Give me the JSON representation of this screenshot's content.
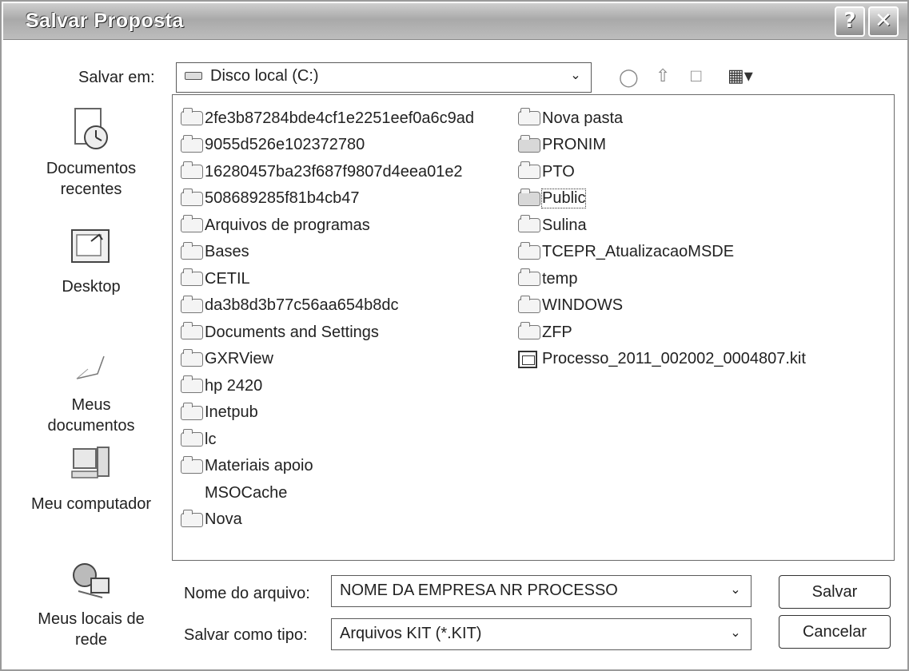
{
  "dialog": {
    "title": "Salvar Proposta",
    "help_button": "?",
    "close_button": "✕"
  },
  "toolbar": {
    "save_in_label": "Salvar em:",
    "save_in_value": "Disco local (C:)",
    "back_icon": "back-icon",
    "up_icon": "up-folder-icon",
    "new_folder_icon": "new-folder-icon",
    "views_icon": "views-menu-icon"
  },
  "places": [
    {
      "label_line1": "Documentos",
      "label_line2": "recentes",
      "icon": "recent-documents-icon"
    },
    {
      "label_line1": "Desktop",
      "label_line2": "",
      "icon": "desktop-icon"
    },
    {
      "label_line1": "Meus",
      "label_line2": "documentos",
      "icon": "my-documents-icon"
    },
    {
      "label_line1": "Meu computador",
      "label_line2": "",
      "icon": "my-computer-icon"
    },
    {
      "label_line1": "Meus locais de",
      "label_line2": "rede",
      "icon": "network-places-icon"
    }
  ],
  "files": {
    "column1": [
      {
        "name": "2fe3b87284bde4cf1e2251eef0a6c9ad",
        "type": "folder"
      },
      {
        "name": "9055d526e102372780",
        "type": "folder"
      },
      {
        "name": "16280457ba23f687f9807d4eea01e2",
        "type": "folder"
      },
      {
        "name": "508689285f81b4cb47",
        "type": "folder"
      },
      {
        "name": "Arquivos de programas",
        "type": "folder"
      },
      {
        "name": "Bases",
        "type": "folder"
      },
      {
        "name": "CETIL",
        "type": "folder"
      },
      {
        "name": "da3b8d3b77c56aa654b8dc",
        "type": "folder"
      },
      {
        "name": "Documents and Settings",
        "type": "folder"
      },
      {
        "name": "GXRView",
        "type": "folder"
      },
      {
        "name": "hp 2420",
        "type": "folder"
      },
      {
        "name": "Inetpub",
        "type": "folder"
      },
      {
        "name": "lc",
        "type": "folder"
      },
      {
        "name": "Materiais apoio",
        "type": "folder"
      },
      {
        "name": "MSOCache",
        "type": "hidden"
      },
      {
        "name": "Nova",
        "type": "folder"
      }
    ],
    "column2": [
      {
        "name": "Nova pasta",
        "type": "folder"
      },
      {
        "name": "PRONIM",
        "type": "shared"
      },
      {
        "name": "PTO",
        "type": "folder"
      },
      {
        "name": "Public",
        "type": "shared",
        "selected": true
      },
      {
        "name": "Sulina",
        "type": "folder"
      },
      {
        "name": "TCEPR_AtualizacaoMSDE",
        "type": "folder"
      },
      {
        "name": "temp",
        "type": "folder"
      },
      {
        "name": "WINDOWS",
        "type": "folder"
      },
      {
        "name": "ZFP",
        "type": "folder"
      },
      {
        "name": "Processo_2011_002002_0004807.kit",
        "type": "kit"
      }
    ]
  },
  "filename": {
    "label": "Nome do arquivo:",
    "value": "NOME DA EMPRESA NR PROCESSO"
  },
  "filetype": {
    "label": "Salvar como tipo:",
    "value": "Arquivos KIT (*.KIT)"
  },
  "buttons": {
    "save": "Salvar",
    "cancel": "Cancelar"
  }
}
